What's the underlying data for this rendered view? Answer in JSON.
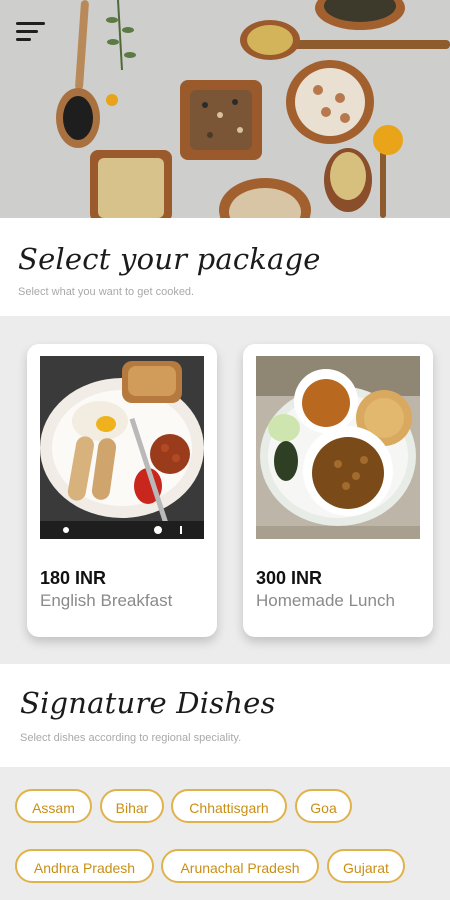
{
  "app": {
    "menu_icon": "hamburger-menu-icon"
  },
  "packages_section": {
    "title": "Select your package",
    "subtitle": "Select what you want to get cooked."
  },
  "packages": [
    {
      "price": "180 INR",
      "name": "English Breakfast",
      "image": "breakfast-plate-photo"
    },
    {
      "price": "300 INR",
      "name": "Homemade Lunch",
      "image": "lunch-plate-photo"
    }
  ],
  "signature_section": {
    "title": "Signature Dishes",
    "subtitle": "Select dishes according to regional speciality."
  },
  "regions": [
    "Assam",
    "Bihar",
    "Chhattisgarh",
    "Goa",
    "Andhra Pradesh",
    "Arunachal Pradesh",
    "Gujarat"
  ],
  "colors": {
    "chip_border": "#e0b24c",
    "chip_text": "#c98f15",
    "background": "#ececec",
    "price_text": "#111111",
    "name_text": "#8a8a8a"
  }
}
